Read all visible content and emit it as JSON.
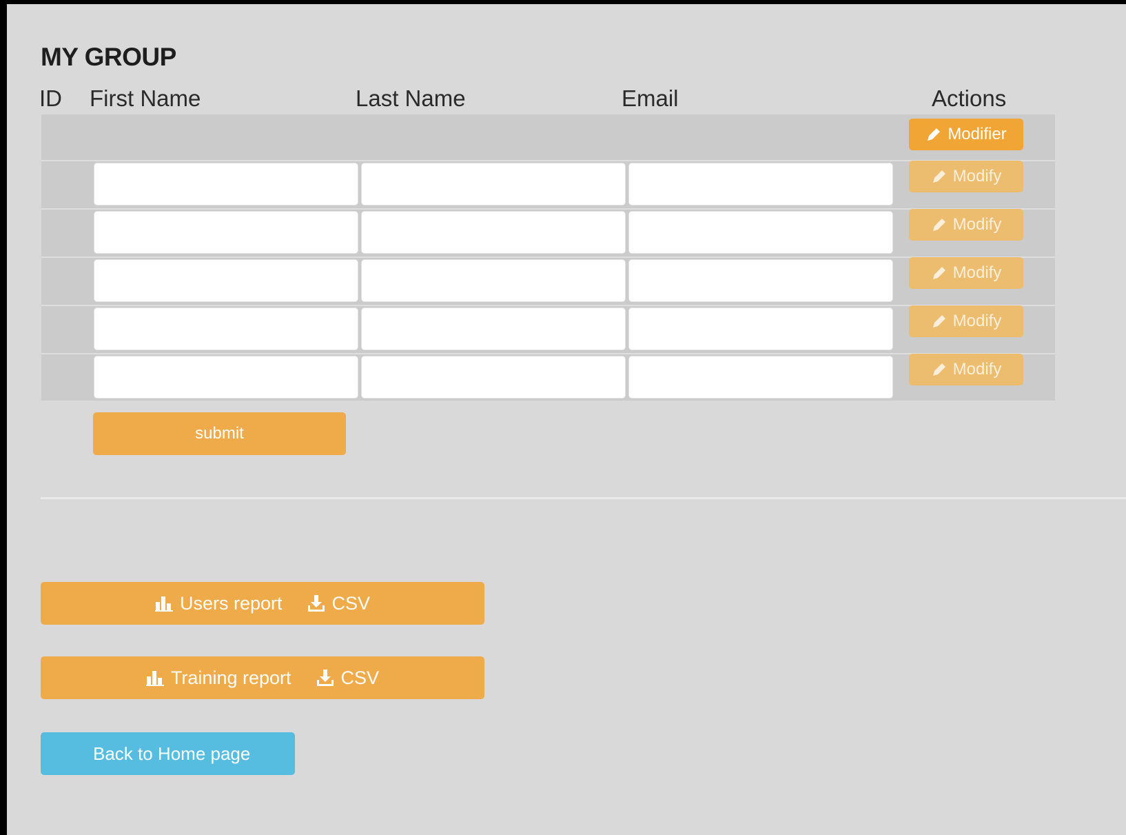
{
  "group": {
    "title": "MY GROUP"
  },
  "table": {
    "headers": {
      "id": "ID",
      "first_name": "First Name",
      "last_name": "Last Name",
      "email": "Email",
      "actions": "Actions"
    },
    "header_row": {
      "action_label": "Modifier",
      "action_icon": "pencil-icon"
    },
    "rows": [
      {
        "first_name": "",
        "last_name": "",
        "email": "",
        "action_label": "Modify"
      },
      {
        "first_name": "",
        "last_name": "",
        "email": "",
        "action_label": "Modify"
      },
      {
        "first_name": "",
        "last_name": "",
        "email": "",
        "action_label": "Modify"
      },
      {
        "first_name": "",
        "last_name": "",
        "email": "",
        "action_label": "Modify"
      },
      {
        "first_name": "",
        "last_name": "",
        "email": "",
        "action_label": "Modify"
      }
    ]
  },
  "form": {
    "submit_label": "submit"
  },
  "reports": {
    "users": {
      "label": "Users report",
      "format": "CSV",
      "icon": "bar-chart-icon",
      "download_icon": "download-icon"
    },
    "training": {
      "label": "Training report",
      "format": "CSV",
      "icon": "bar-chart-icon",
      "download_icon": "download-icon"
    }
  },
  "navigation": {
    "home_label": "Back to Home page"
  },
  "colors": {
    "background": "#d9d9d9",
    "primary": "#f0a535",
    "primary_faded": "#edbd6f",
    "info": "#57bde0",
    "table_row": "#cbcbcb"
  }
}
